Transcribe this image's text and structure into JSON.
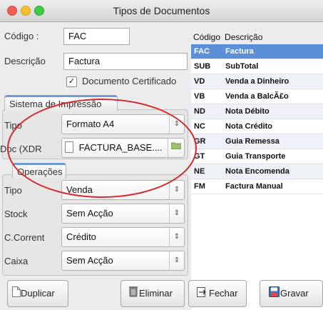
{
  "window": {
    "title": "Tipos de Documentos"
  },
  "form": {
    "codigo_label": "Código :",
    "codigo_value": "FAC",
    "descricao_label": "Descrição",
    "descricao_value": "Factura",
    "certificado_label": "Documento Certificado",
    "certificado_checked": true,
    "check_mark": "✓"
  },
  "impressao": {
    "tab_label": "Sistema de Impressão",
    "tipo_label": "Tipo",
    "tipo_value": "Formato A4",
    "doc_label": "Doc (XDR",
    "doc_value": "FACTURA_BASE...."
  },
  "operacoes": {
    "tab_label": "Operações",
    "tipo_label": "Tipo",
    "tipo_value": "Venda",
    "stock_label": "Stock",
    "stock_value": "Sem Acção",
    "ccorrent_label": "C.Corrent",
    "ccorrent_value": "Crédito",
    "caixa_label": "Caixa",
    "caixa_value": "Sem Acção"
  },
  "grid": {
    "headers": [
      "Código",
      "Descrição"
    ],
    "rows": [
      {
        "code": "FAC",
        "desc": "Factura",
        "selected": true
      },
      {
        "code": "SUB",
        "desc": "SubTotal"
      },
      {
        "code": "VD",
        "desc": "Venda a Dinheiro"
      },
      {
        "code": "VB",
        "desc": "Venda a BalcÃ£o"
      },
      {
        "code": "ND",
        "desc": "Nota Débito"
      },
      {
        "code": "NC",
        "desc": "Nota Crédito"
      },
      {
        "code": "GR",
        "desc": "Guia Remessa"
      },
      {
        "code": "GT",
        "desc": "Guia Transporte"
      },
      {
        "code": "NE",
        "desc": "Nota Encomenda"
      },
      {
        "code": "FM",
        "desc": "Factura Manual"
      }
    ]
  },
  "buttons": {
    "duplicar": "Duplicar",
    "eliminar": "Eliminar",
    "fechar": "Fechar",
    "gravar": "Gravar"
  },
  "colors": {
    "selection": "#5b8fd8",
    "annotation": "#d9242a",
    "tab_accent": "#6f9ad6"
  },
  "icons": {
    "combo_arrow": "up-down-arrows-icon",
    "duplicar": "document-icon",
    "eliminar": "trash-icon",
    "fechar": "exit-icon",
    "gravar": "save-icon",
    "doc": "document-icon",
    "folder": "folder-icon"
  }
}
